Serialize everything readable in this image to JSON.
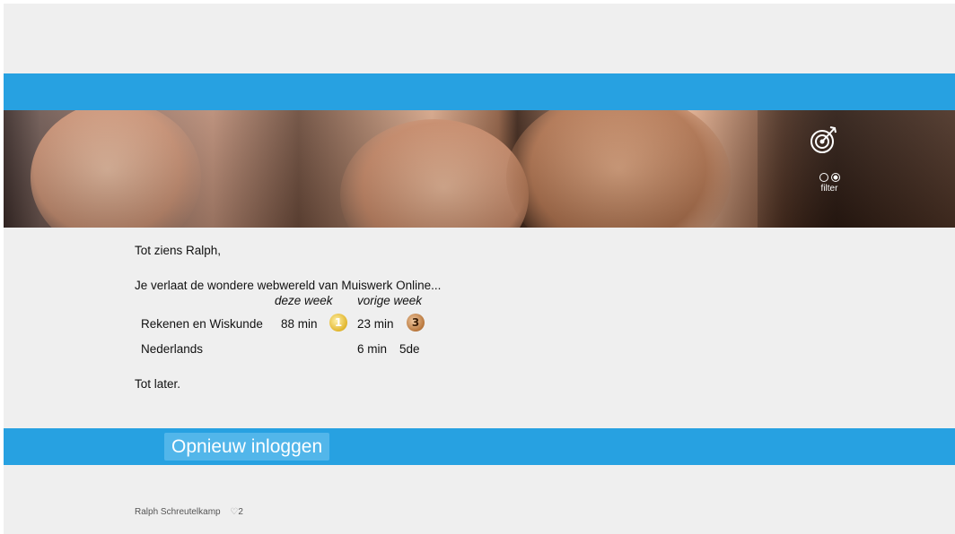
{
  "banner": {
    "filter_label": "filter",
    "icons": [
      "target-icon",
      "radio-off-icon",
      "radio-on-icon"
    ]
  },
  "message": {
    "greeting": "Tot ziens Ralph,",
    "leaving": "Je verlaat de wondere webwereld van Muiswerk Online...",
    "columns": [
      "deze week",
      "vorige week"
    ],
    "rows": [
      {
        "subject": "Rekenen en Wiskunde",
        "this_week": "88 min",
        "this_medal": "1",
        "last_week": "23 min",
        "last_medal": "3"
      },
      {
        "subject": "Nederlands",
        "this_week": "",
        "this_medal": "",
        "last_week": "6 min",
        "last_rank": "5de"
      }
    ],
    "closing": "Tot later."
  },
  "actions": {
    "login_again": "Opnieuw inloggen"
  },
  "footer": {
    "user": "Ralph Schreutelkamp",
    "heart_icon": "heart-icon",
    "likes": "2"
  },
  "colors": {
    "accent": "#27a1e1",
    "button": "#52b6ea",
    "background": "#efefef"
  }
}
